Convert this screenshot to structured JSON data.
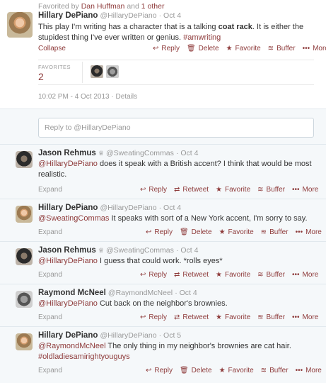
{
  "main": {
    "favorited_by": "Favorited by",
    "fav_user1": "Dan Huffman",
    "fav_and": "and",
    "fav_other": "1 other",
    "name": "Hillary DePiano",
    "handle": "@HillaryDePiano",
    "time": "· Oct 4",
    "text_a": "This play I'm writing has a character that is a talking ",
    "text_bold": "coat rack",
    "text_b": ". It is either the stupidest thing I've ever written or genius. ",
    "hashtag": "#amwriting",
    "collapse": "Collapse",
    "actions": {
      "reply": "Reply",
      "delete": "Delete",
      "favorite": "Favorite",
      "buffer": "Buffer",
      "more": "More"
    },
    "favorites_label": "FAVORITES",
    "favorites_count": "2",
    "meta_time": "10:02 PM - 4 Oct 2013",
    "meta_sep": "·",
    "meta_details": "Details",
    "reply_placeholder": "Reply to @HillaryDePiano"
  },
  "replies": [
    {
      "name": "Jason Rehmus",
      "badge": "♕",
      "handle": "@SweatingCommas",
      "time": "· Oct 4",
      "mention": "@HillaryDePiano",
      "text": " does it speak with a British accent? I think that would be most realistic.",
      "expand": "Expand",
      "a1": "Reply",
      "a2": "Retweet",
      "a3": "Favorite",
      "a4": "Buffer",
      "a5": "More"
    },
    {
      "name": "Hillary DePiano",
      "handle": "@HillaryDePiano",
      "time": "· Oct 4",
      "mention": "@SweatingCommas",
      "text": " It speaks with sort of a New York accent, I'm sorry to say.",
      "expand": "Expand",
      "a1": "Reply",
      "a2": "Delete",
      "a3": "Favorite",
      "a4": "Buffer",
      "a5": "More"
    },
    {
      "name": "Jason Rehmus",
      "badge": "♕",
      "handle": "@SweatingCommas",
      "time": "· Oct 4",
      "mention": "@HillaryDePiano",
      "text": " I guess that could work. *rolls eyes*",
      "expand": "Expand",
      "a1": "Reply",
      "a2": "Retweet",
      "a3": "Favorite",
      "a4": "Buffer",
      "a5": "More"
    },
    {
      "name": "Raymond McNeel",
      "handle": "@RaymondMcNeel",
      "time": "· Oct 4",
      "mention": "@HillaryDePiano",
      "text": " Cut back on the neighbor's brownies.",
      "expand": "Expand",
      "a1": "Reply",
      "a2": "Retweet",
      "a3": "Favorite",
      "a4": "Buffer",
      "a5": "More"
    },
    {
      "name": "Hillary DePiano",
      "handle": "@HillaryDePiano",
      "time": "· Oct 5",
      "mention": "@RaymondMcNeel",
      "text": " The only thing in my neighbor's brownies are cat hair.",
      "hashtag": "#oldladiesamirightyouguys",
      "expand": "Expand",
      "a1": "Reply",
      "a2": "Delete",
      "a3": "Favorite",
      "a4": "Buffer",
      "a5": "More"
    }
  ],
  "icons": {
    "reply": "reply-icon",
    "delete": "trash-icon",
    "retweet": "retweet-icon",
    "favorite": "star-icon",
    "buffer": "buffer-icon",
    "more": "ellipsis-icon"
  },
  "colors": {
    "link": "#8e3b3b",
    "muted": "#999999",
    "reply_bg": "#f5f8fa"
  }
}
